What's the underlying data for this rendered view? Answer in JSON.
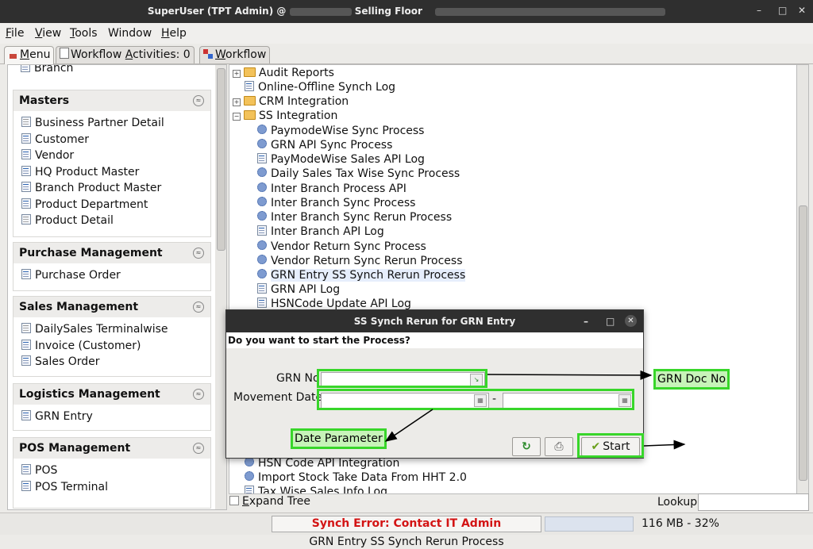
{
  "window": {
    "title_prefix": "SuperUser (TPT Admin) @",
    "title_suffix": "Selling Floor",
    "min_glyph": "–",
    "max_glyph": "□",
    "close_glyph": "✕"
  },
  "menubar": {
    "items": [
      {
        "key": "F",
        "rest": "ile"
      },
      {
        "key": "V",
        "rest": "iew"
      },
      {
        "key": "T",
        "rest": "ools"
      },
      {
        "key": "",
        "rest": "Window"
      },
      {
        "key": "H",
        "rest": "elp"
      }
    ]
  },
  "tabs": [
    {
      "key": "M",
      "rest": "enu"
    },
    {
      "label": "Workflow ",
      "key": "A",
      "rest": "ctivities: 0"
    },
    {
      "key": "W",
      "rest": "orkflow"
    }
  ],
  "left": {
    "top_item": "Branch",
    "sections": [
      {
        "title": "Masters",
        "items": [
          "Business Partner Detail",
          "Customer",
          "Vendor",
          "HQ Product Master",
          "Branch Product Master",
          "Product Department",
          "Product Detail"
        ]
      },
      {
        "title": "Purchase Management",
        "items": [
          "Purchase Order"
        ]
      },
      {
        "title": "Sales Management",
        "items": [
          "DailySales Terminalwise",
          "Invoice (Customer)",
          "Sales Order"
        ]
      },
      {
        "title": "Logistics Management",
        "items": [
          "GRN Entry"
        ]
      },
      {
        "title": "POS Management",
        "items": [
          "POS",
          "POS Terminal"
        ]
      }
    ],
    "collapse_glyph": "≈"
  },
  "tree": {
    "nodes": [
      {
        "label": "Audit Reports"
      },
      {
        "label": "Online-Offline Synch Log"
      },
      {
        "label": "CRM Integration"
      },
      {
        "label": "SS Integration"
      },
      {
        "label": "PaymodeWise Sync Process"
      },
      {
        "label": "GRN API Sync Process"
      },
      {
        "label": "PayModeWise Sales API Log"
      },
      {
        "label": "Daily Sales Tax Wise Sync Process"
      },
      {
        "label": "Inter Branch Process API"
      },
      {
        "label": "Inter Branch Sync Process"
      },
      {
        "label": "Inter Branch Sync Rerun Process"
      },
      {
        "label": "Inter Branch API Log"
      },
      {
        "label": "Vendor Return Sync Process"
      },
      {
        "label": "Vendor Return Sync Rerun Process"
      },
      {
        "label": "GRN Entry SS Synch Rerun Process"
      },
      {
        "label": "GRN API Log"
      },
      {
        "label": "HSNCode Update API Log"
      },
      {
        "label": "HSN Code API Integration"
      },
      {
        "label": "Import Stock Take Data From HHT 2.0"
      },
      {
        "label": "Tax Wise Sales Info Log"
      }
    ],
    "plus": "+",
    "minus": "−"
  },
  "bottom": {
    "expand_key": "E",
    "expand_rest": "xpand Tree",
    "lookup_label": "Lookup",
    "lookup_value": "",
    "synch_error": "Synch Error: Contact IT Admin",
    "memory": "116 MB - 32%",
    "footer": "GRN Entry SS Synch Rerun Process"
  },
  "dialog": {
    "title": "SS Synch Rerun for GRN Entry",
    "question": "Do you want to start the Process?",
    "grn_label": "GRN No",
    "grn_value": "",
    "movement_label": "Movement Date",
    "date_from": "",
    "date_to": "",
    "date_sep": "-",
    "start_label": "Start",
    "refresh_glyph": "↻",
    "print_glyph": "⎙",
    "check_glyph": "✔",
    "lookup_glyph": "↘",
    "cal_glyph": "▦"
  },
  "annotations": {
    "grn_doc_no": "GRN Doc No",
    "date_parameter": "Date Parameter"
  },
  "colors": {
    "highlight": "#38d62a",
    "error": "#d31414"
  }
}
